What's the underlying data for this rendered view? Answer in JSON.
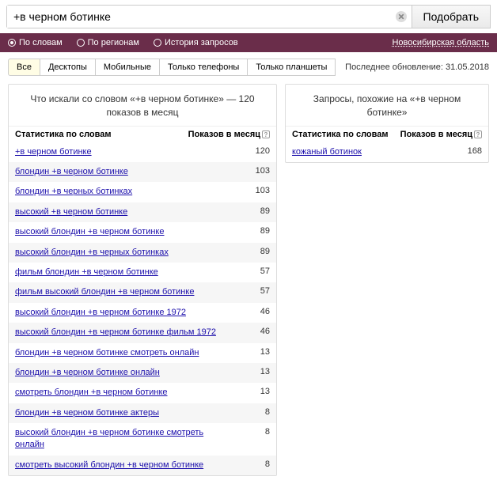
{
  "search": {
    "value": "+в черном ботинке",
    "submit": "Подобрать"
  },
  "filters": {
    "by_words": "По словам",
    "by_regions": "По регионам",
    "history": "История запросов",
    "region": "Новосибирская область"
  },
  "tabs": {
    "all": "Все",
    "desktops": "Десктопы",
    "mobiles": "Мобильные",
    "phones_only": "Только телефоны",
    "tablets_only": "Только планшеты"
  },
  "last_update": "Последнее обновление: 31.05.2018",
  "left": {
    "title": "Что искали со словом «+в черном ботинке» — 120 показов в месяц",
    "col_q": "Статистика по словам",
    "col_n": "Показов в месяц",
    "rows": [
      {
        "q": "+в черном ботинке",
        "n": "120"
      },
      {
        "q": "блондин +в черном ботинке",
        "n": "103"
      },
      {
        "q": "блондин +в черных ботинках",
        "n": "103"
      },
      {
        "q": "высокий +в черном ботинке",
        "n": "89"
      },
      {
        "q": "высокий блондин +в черном ботинке",
        "n": "89"
      },
      {
        "q": "высокий блондин +в черных ботинках",
        "n": "89"
      },
      {
        "q": "фильм блондин +в черном ботинке",
        "n": "57"
      },
      {
        "q": "фильм высокий блондин +в черном ботинке",
        "n": "57"
      },
      {
        "q": "высокий блондин +в черном ботинке 1972",
        "n": "46"
      },
      {
        "q": "высокий блондин +в черном ботинке фильм 1972",
        "n": "46"
      },
      {
        "q": "блондин +в черном ботинке смотреть онлайн",
        "n": "13"
      },
      {
        "q": "блондин +в черном ботинке онлайн",
        "n": "13"
      },
      {
        "q": "смотреть блондин +в черном ботинке",
        "n": "13"
      },
      {
        "q": "блондин +в черном ботинке актеры",
        "n": "8"
      },
      {
        "q": "высокий блондин +в черном ботинке смотреть онлайн",
        "n": "8"
      },
      {
        "q": "смотреть высокий блондин +в черном ботинке",
        "n": "8"
      }
    ]
  },
  "right": {
    "title": "Запросы, похожие на «+в черном ботинке»",
    "col_q": "Статистика по словам",
    "col_n": "Показов в месяц",
    "rows": [
      {
        "q": "кожаный ботинок",
        "n": "168"
      }
    ]
  },
  "help_mark": "?"
}
